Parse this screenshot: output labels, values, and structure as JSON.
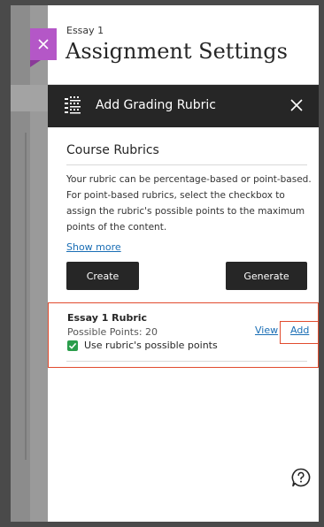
{
  "settings": {
    "breadcrumb": "Essay 1",
    "title": "Assignment Settings",
    "close_tab_icon": "close-icon",
    "accent_color": "#b457c7"
  },
  "rubric_panel": {
    "header_title": "Add Grading Rubric",
    "header_icon": "rubric-icon",
    "close_icon": "close-icon",
    "section_title": "Course Rubrics",
    "description": "Your rubric can be percentage-based or point-based. For point-based rubrics, select the checkbox to assign the rubric's possible points to the maximum points of the content.",
    "show_more_label": "Show more",
    "create_label": "Create",
    "generate_label": "Generate",
    "rubrics": [
      {
        "name": "Essay 1 Rubric",
        "points": "Possible Points: 20",
        "checkbox_label": "Use rubric's possible points",
        "checked": true,
        "view_label": "View",
        "add_label": "Add"
      }
    ],
    "help_icon": "help-icon",
    "highlight_color": "#e14b2e",
    "link_color": "#1a6eb5",
    "check_color": "#2a9d4b"
  }
}
